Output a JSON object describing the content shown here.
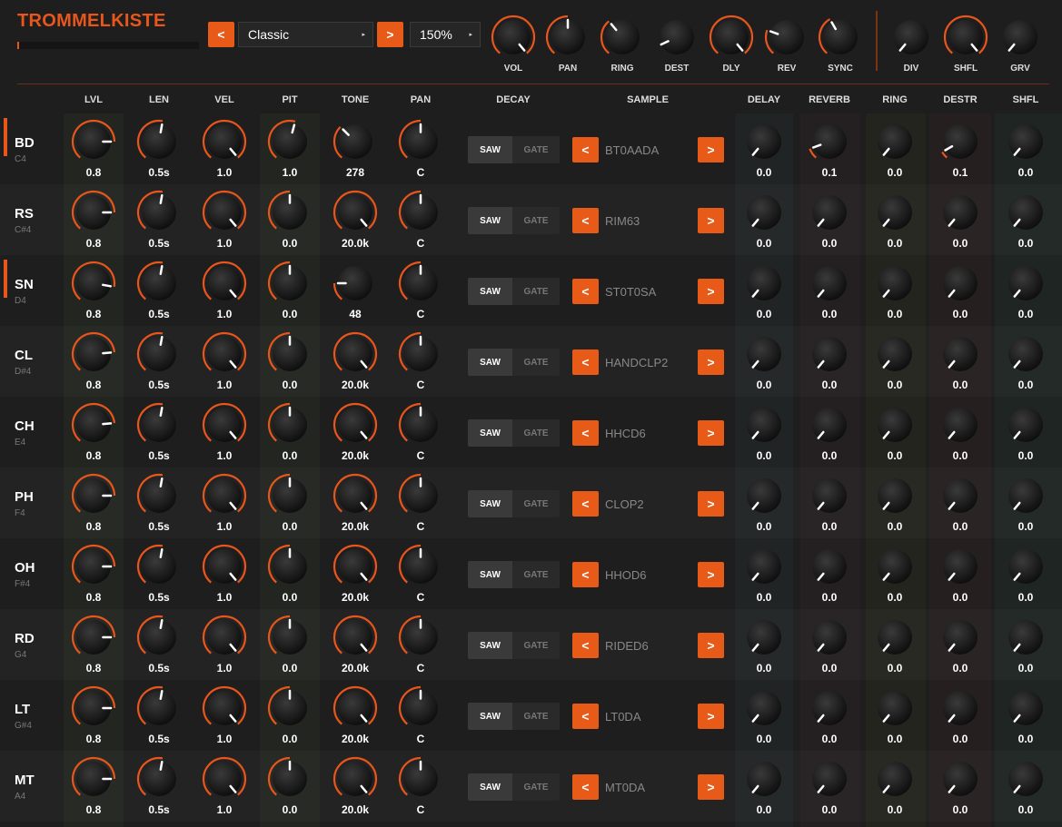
{
  "app": {
    "title": "TROMMELKISTE"
  },
  "preset": {
    "prev": "<",
    "name": "Classic",
    "next": ">",
    "zoom": "150%",
    "dropdown_icon": "▸"
  },
  "global_knobs": [
    {
      "label": "VOL",
      "angle": 140,
      "arc": 1
    },
    {
      "label": "PAN",
      "angle": 0,
      "arc": 1
    },
    {
      "label": "RING",
      "angle": -40,
      "arc": 1
    },
    {
      "label": "DEST",
      "angle": -115,
      "arc": 0
    },
    {
      "label": "DLY",
      "angle": 140,
      "arc": 1
    },
    {
      "label": "REV",
      "angle": -70,
      "arc": 1
    },
    {
      "label": "SYNC",
      "angle": -30,
      "arc": 1
    },
    {
      "label": "DIV",
      "angle": -140,
      "arc": 0
    },
    {
      "label": "SHFL",
      "angle": 140,
      "arc": 1
    },
    {
      "label": "GRV",
      "angle": -140,
      "arc": 0
    }
  ],
  "columns": [
    "LVL",
    "LEN",
    "VEL",
    "PIT",
    "TONE",
    "PAN",
    "DECAY",
    "SAMPLE",
    "DELAY",
    "REVERB",
    "RING",
    "DESTR",
    "SHFL"
  ],
  "toggle": {
    "saw": "SAW",
    "gate": "GATE"
  },
  "nav": {
    "prev": "<",
    "next": ">"
  },
  "rows": [
    {
      "name": "BD",
      "note": "C4",
      "active": true,
      "vals": [
        "0.8",
        "0.5s",
        "1.0",
        "1.0",
        "278",
        "C"
      ],
      "ang": [
        90,
        10,
        140,
        15,
        -45,
        0
      ],
      "sample": "BT0AADA",
      "fx": [
        "0.0",
        "0.1",
        "0.0",
        "0.1",
        "0.0"
      ],
      "fxang": [
        -140,
        -110,
        -140,
        -120,
        -140
      ]
    },
    {
      "name": "RS",
      "note": "C#4",
      "active": false,
      "vals": [
        "0.8",
        "0.5s",
        "1.0",
        "0.0",
        "20.0k",
        "C"
      ],
      "ang": [
        90,
        10,
        140,
        0,
        140,
        0
      ],
      "sample": "RIM63",
      "fx": [
        "0.0",
        "0.0",
        "0.0",
        "0.0",
        "0.0"
      ],
      "fxang": [
        -140,
        -140,
        -140,
        -140,
        -140
      ]
    },
    {
      "name": "SN",
      "note": "D4",
      "active": true,
      "vals": [
        "0.8",
        "0.5s",
        "1.0",
        "0.0",
        "48",
        "C"
      ],
      "ang": [
        100,
        10,
        140,
        0,
        -90,
        0
      ],
      "sample": "ST0T0SA",
      "fx": [
        "0.0",
        "0.0",
        "0.0",
        "0.0",
        "0.0"
      ],
      "fxang": [
        -140,
        -140,
        -140,
        -140,
        -140
      ]
    },
    {
      "name": "CL",
      "note": "D#4",
      "active": false,
      "vals": [
        "0.8",
        "0.5s",
        "1.0",
        "0.0",
        "20.0k",
        "C"
      ],
      "ang": [
        85,
        10,
        140,
        0,
        140,
        0
      ],
      "sample": "HANDCLP2",
      "fx": [
        "0.0",
        "0.0",
        "0.0",
        "0.0",
        "0.0"
      ],
      "fxang": [
        -140,
        -140,
        -140,
        -140,
        -140
      ]
    },
    {
      "name": "CH",
      "note": "E4",
      "active": false,
      "vals": [
        "0.8",
        "0.5s",
        "1.0",
        "0.0",
        "20.0k",
        "C"
      ],
      "ang": [
        85,
        10,
        140,
        0,
        140,
        0
      ],
      "sample": "HHCD6",
      "fx": [
        "0.0",
        "0.0",
        "0.0",
        "0.0",
        "0.0"
      ],
      "fxang": [
        -140,
        -140,
        -140,
        -140,
        -140
      ]
    },
    {
      "name": "PH",
      "note": "F4",
      "active": false,
      "vals": [
        "0.8",
        "0.5s",
        "1.0",
        "0.0",
        "20.0k",
        "C"
      ],
      "ang": [
        90,
        10,
        140,
        0,
        140,
        0
      ],
      "sample": "CLOP2",
      "fx": [
        "0.0",
        "0.0",
        "0.0",
        "0.0",
        "0.0"
      ],
      "fxang": [
        -140,
        -140,
        -140,
        -140,
        -140
      ]
    },
    {
      "name": "OH",
      "note": "F#4",
      "active": false,
      "vals": [
        "0.8",
        "0.5s",
        "1.0",
        "0.0",
        "20.0k",
        "C"
      ],
      "ang": [
        90,
        10,
        140,
        0,
        140,
        0
      ],
      "sample": "HHOD6",
      "fx": [
        "0.0",
        "0.0",
        "0.0",
        "0.0",
        "0.0"
      ],
      "fxang": [
        -140,
        -140,
        -140,
        -140,
        -140
      ]
    },
    {
      "name": "RD",
      "note": "G4",
      "active": false,
      "vals": [
        "0.8",
        "0.5s",
        "1.0",
        "0.0",
        "20.0k",
        "C"
      ],
      "ang": [
        90,
        10,
        140,
        0,
        140,
        0
      ],
      "sample": "RIDED6",
      "fx": [
        "0.0",
        "0.0",
        "0.0",
        "0.0",
        "0.0"
      ],
      "fxang": [
        -140,
        -140,
        -140,
        -140,
        -140
      ]
    },
    {
      "name": "LT",
      "note": "G#4",
      "active": false,
      "vals": [
        "0.8",
        "0.5s",
        "1.0",
        "0.0",
        "20.0k",
        "C"
      ],
      "ang": [
        90,
        10,
        140,
        0,
        140,
        0
      ],
      "sample": "LT0DA",
      "fx": [
        "0.0",
        "0.0",
        "0.0",
        "0.0",
        "0.0"
      ],
      "fxang": [
        -140,
        -140,
        -140,
        -140,
        -140
      ]
    },
    {
      "name": "MT",
      "note": "A4",
      "active": false,
      "vals": [
        "0.8",
        "0.5s",
        "1.0",
        "0.0",
        "20.0k",
        "C"
      ],
      "ang": [
        90,
        10,
        140,
        0,
        140,
        0
      ],
      "sample": "MT0DA",
      "fx": [
        "0.0",
        "0.0",
        "0.0",
        "0.0",
        "0.0"
      ],
      "fxang": [
        -140,
        -140,
        -140,
        -140,
        -140
      ]
    }
  ],
  "colors": {
    "accent": "#e8561c",
    "bg": "#1e1e1e"
  }
}
